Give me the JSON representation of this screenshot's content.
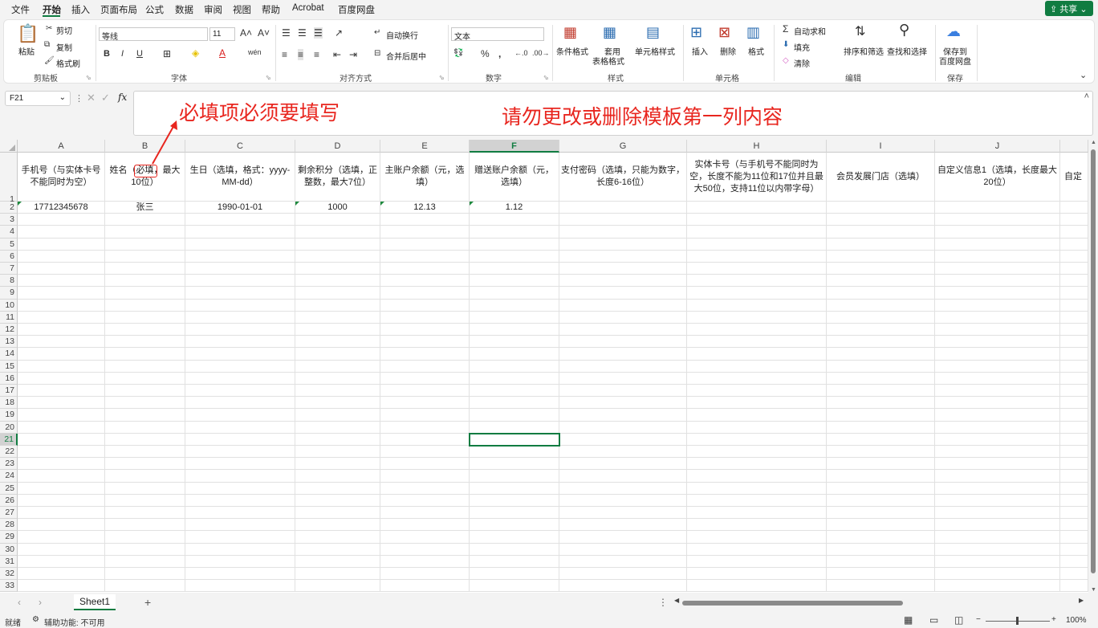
{
  "menu": {
    "items": [
      "文件",
      "开始",
      "插入",
      "页面布局",
      "公式",
      "数据",
      "审阅",
      "视图",
      "帮助",
      "Acrobat",
      "百度网盘"
    ],
    "active_index": 1,
    "share_label": "共享"
  },
  "ribbon": {
    "clipboard": {
      "paste": "粘贴",
      "cut": "剪切",
      "copy": "复制",
      "format_painter": "格式刷",
      "group": "剪贴板"
    },
    "font": {
      "name": "等线",
      "size": "11",
      "group": "字体"
    },
    "alignment": {
      "wrap": "自动换行",
      "merge": "合并后居中",
      "group": "对齐方式"
    },
    "number": {
      "format": "文本",
      "group": "数字"
    },
    "styles": {
      "conditional": "条件格式",
      "table_fmt_1": "套用",
      "table_fmt_2": "表格格式",
      "cell_styles": "单元格样式",
      "group": "样式"
    },
    "cells": {
      "insert": "插入",
      "delete": "删除",
      "format": "格式",
      "group": "单元格"
    },
    "editing": {
      "autosum": "自动求和",
      "fill": "填充",
      "clear": "清除",
      "sort": "排序和筛选",
      "find": "查找和选择",
      "group": "编辑"
    },
    "save": {
      "line1": "保存到",
      "line2": "百度网盘",
      "group": "保存"
    }
  },
  "formula_bar": {
    "name_box": "F21",
    "fx": "fx"
  },
  "annotations": {
    "required": "必填项必须要填写",
    "warning": "请勿更改或删除模板第一列内容"
  },
  "grid": {
    "columns": [
      "A",
      "B",
      "C",
      "D",
      "E",
      "F",
      "G",
      "H",
      "I",
      "J",
      ""
    ],
    "selected_col_index": 5,
    "selected_row": 21,
    "headers": [
      "手机号（与实体卡号不能同时为空）",
      "姓名（必填，最大10位）",
      "生日（选填，格式：yyyy-MM-dd）",
      "剩余积分（选填，正整数，最大7位）",
      "主账户余额（元，选填）",
      "赠送账户余额（元，选填）",
      "支付密码（选填，只能为数字，长度6-16位）",
      "实体卡号（与手机号不能同时为空，长度不能为11位和17位并且最大50位，支持11位以内带字母）",
      "会员发展门店（选填）",
      "自定义信息1（选填，长度最大20位）",
      "自定"
    ],
    "row2": [
      "17712345678",
      "张三",
      "1990-01-01",
      "1000",
      "12.13",
      "1.12",
      "",
      "",
      "",
      "",
      ""
    ]
  },
  "sheets": {
    "active": "Sheet1",
    "add": "+"
  },
  "status": {
    "ready": "就绪",
    "accessibility": "辅助功能: 不可用",
    "zoom": "100%"
  }
}
